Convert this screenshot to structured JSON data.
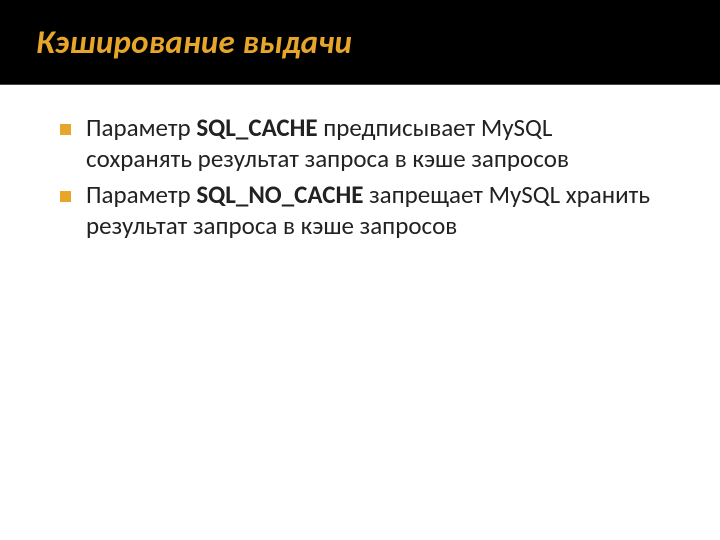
{
  "title": "Кэширование выдачи",
  "bullets": [
    {
      "prefix": "Параметр ",
      "keyword": "SQL_CACHE",
      "suffix": " предписывает MySQL сохранять результат запроса в кэше запросов"
    },
    {
      "prefix": "Параметр ",
      "keyword": "SQL_NO_CACHE",
      "suffix": " запрещает MySQL хранить результат запроса в кэше запросов"
    }
  ]
}
